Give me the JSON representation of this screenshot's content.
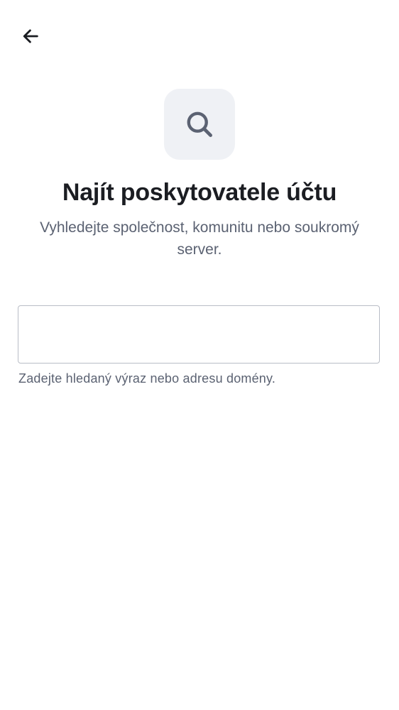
{
  "header": {
    "back_icon": "arrow-left-icon"
  },
  "hero": {
    "icon": "search-icon",
    "tile_color": "#eff1f5",
    "title": "Najít poskytovatele účtu",
    "subtitle": "Vyhledejte společnost, komunitu nebo soukromý server."
  },
  "search": {
    "value": "",
    "placeholder": "",
    "helper": "Zadejte hledaný výraz nebo adresu domény."
  },
  "colors": {
    "title": "#1b1d22",
    "secondary_text": "#5b6272",
    "field_border": "#b9bdc6",
    "icon": "#5b6272"
  }
}
